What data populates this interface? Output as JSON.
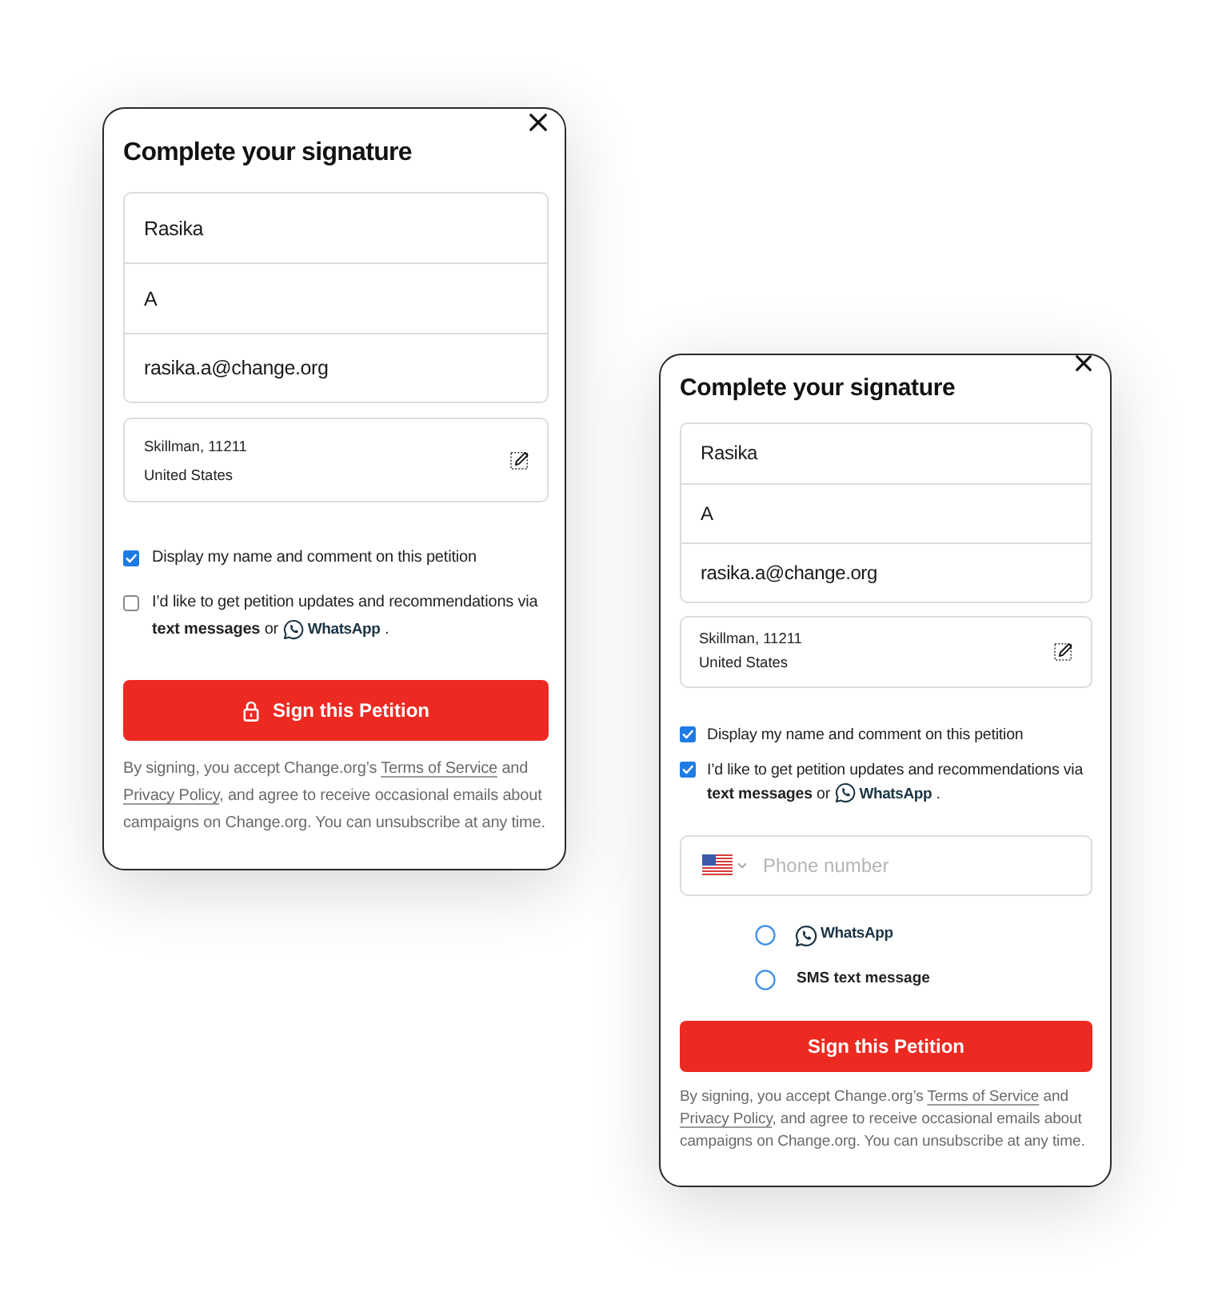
{
  "screens": [
    {
      "title": "Complete your signature",
      "fields": [
        {
          "value": "Rasika"
        },
        {
          "value": "A"
        },
        {
          "value": "rasika.a@change.org"
        }
      ],
      "location": [
        "Skillman, 11211",
        "United States"
      ],
      "options": [
        {
          "kind": "plain",
          "label": "Display my name and comment on this petition",
          "checked": true
        },
        {
          "kind": "channels",
          "label": "I’d like to get petition updates and recommendations via **text messages** or",
          "channel": "WhatsApp",
          "suffix": ".",
          "checked": false
        }
      ],
      "button": {
        "label": "Sign this Petition",
        "lock": true
      },
      "legal": [
        {
          "kind": "text",
          "text": "By signing, you accept Change.org’s "
        },
        {
          "kind": "link",
          "text": "Terms of Service"
        },
        {
          "kind": "text",
          "text": " and "
        },
        {
          "kind": "link",
          "text": "Privacy Policy"
        },
        {
          "kind": "text",
          "text": ", and agree to receive occasional emails about campaigns on Change.org. You can unsubscribe at any time."
        }
      ]
    },
    {
      "title": "Complete your signature",
      "fields": [
        {
          "value": "Rasika"
        },
        {
          "value": "A"
        },
        {
          "value": "rasika.a@change.org"
        }
      ],
      "location": [
        "Skillman, 11211",
        "United States"
      ],
      "options": [
        {
          "kind": "plain",
          "label": "Display my name and comment on this petition",
          "checked": true
        },
        {
          "kind": "channels",
          "label": "I’d like to get petition updates and recommendations via **text messages** or",
          "channel": "WhatsApp",
          "suffix": ".",
          "checked": true
        }
      ],
      "phone": {
        "placeholder": "Phone number"
      },
      "channels": [
        {
          "kind": "whatsapp",
          "label": "WhatsApp",
          "selected": false
        },
        {
          "kind": "sms",
          "label": "SMS text message",
          "selected": false
        }
      ],
      "button": {
        "label": "Sign this Petition",
        "lock": false
      },
      "legal": [
        {
          "kind": "text",
          "text": "By signing, you accept Change.org’s "
        },
        {
          "kind": "link",
          "text": "Terms of Service"
        },
        {
          "kind": "text",
          "text": " and "
        },
        {
          "kind": "link",
          "text": "Privacy Policy"
        },
        {
          "kind": "text",
          "text": ", and agree to receive occasional emails about campaigns on Change.org. You can unsubscribe at any time."
        }
      ]
    }
  ]
}
